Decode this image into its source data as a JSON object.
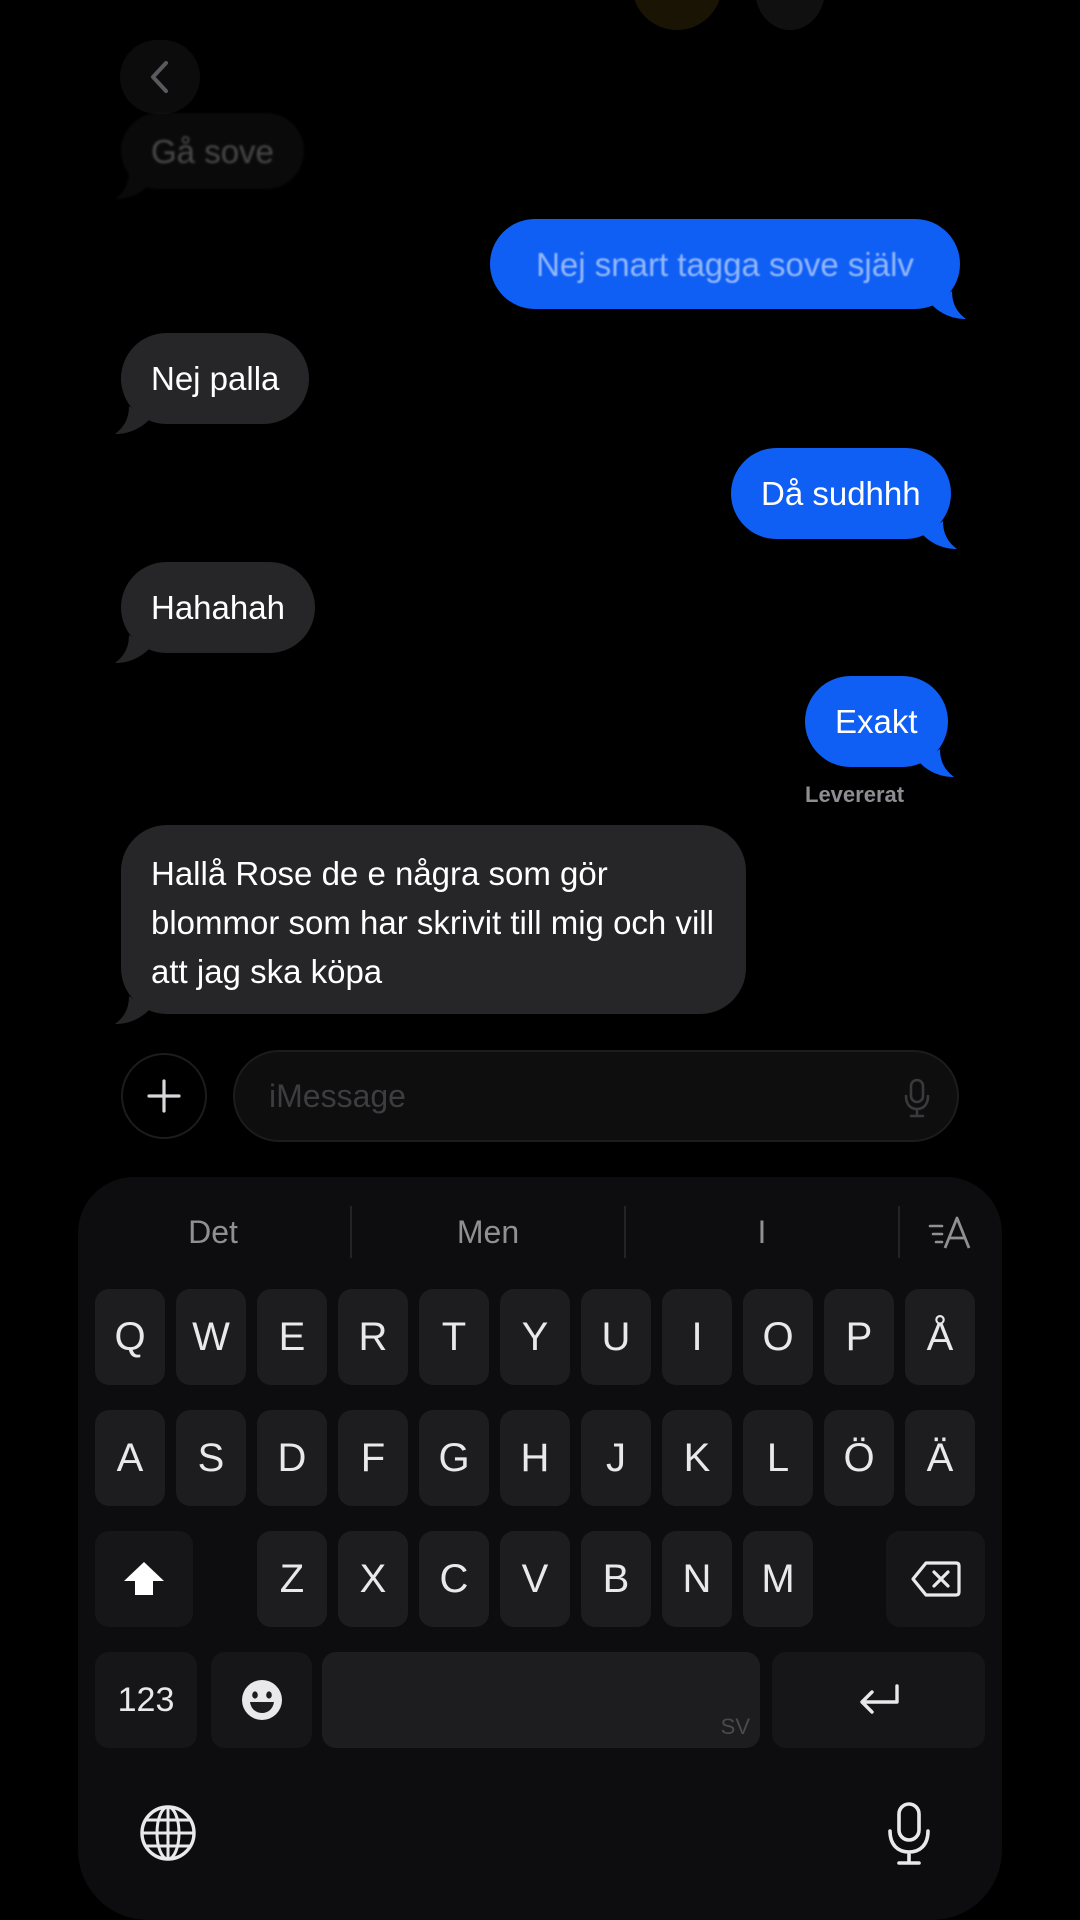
{
  "conversation": {
    "messages": [
      {
        "id": "m1",
        "direction": "in",
        "text": "Gå sove",
        "faded": true
      },
      {
        "id": "m2",
        "direction": "out",
        "text": "Nej snart tagga sove själv",
        "faded": true
      },
      {
        "id": "m3",
        "direction": "in",
        "text": "Nej palla"
      },
      {
        "id": "m4",
        "direction": "out",
        "text": "Då sudhhh"
      },
      {
        "id": "m5",
        "direction": "in",
        "text": "Hahahah"
      },
      {
        "id": "m6",
        "direction": "out",
        "text": "Exakt"
      },
      {
        "id": "m7",
        "direction": "in",
        "text": "Hallå Rose de e några som gör blommor som har skrivit till mig och vill att jag ska köpa"
      }
    ],
    "delivered_label": "Levererat"
  },
  "composer": {
    "placeholder": "iMessage",
    "value": ""
  },
  "keyboard": {
    "suggestions": [
      "Det",
      "Men",
      "I"
    ],
    "format_icon": "text-format-icon",
    "rows": [
      [
        "Q",
        "W",
        "E",
        "R",
        "T",
        "Y",
        "U",
        "I",
        "O",
        "P",
        "Å"
      ],
      [
        "A",
        "S",
        "D",
        "F",
        "G",
        "H",
        "J",
        "K",
        "L",
        "Ö",
        "Ä"
      ],
      [
        "Z",
        "X",
        "C",
        "V",
        "B",
        "N",
        "M"
      ]
    ],
    "numbers_label": "123",
    "space_language": "SV",
    "icons": {
      "shift": "shift-icon",
      "delete": "backspace-icon",
      "emoji": "emoji-icon",
      "return": "return-icon",
      "globe": "globe-icon",
      "dictation": "microphone-icon"
    }
  },
  "colors": {
    "background": "#000000",
    "incoming_bubble": "#262628",
    "outgoing_bubble": "#0f5ff5",
    "keyboard_bg": "#0d0d0f",
    "key_bg": "#1d1d1f"
  }
}
